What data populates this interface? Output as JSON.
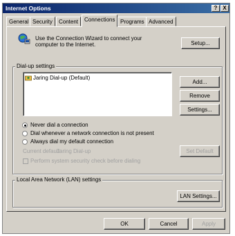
{
  "window": {
    "title": "Internet Options",
    "help_glyph": "?",
    "close_glyph": "X"
  },
  "tabs": [
    {
      "label": "General"
    },
    {
      "label": "Security"
    },
    {
      "label": "Content"
    },
    {
      "label": "Connections"
    },
    {
      "label": "Programs"
    },
    {
      "label": "Advanced"
    }
  ],
  "active_tab": "Connections",
  "setup": {
    "description": "Use the Connection Wizard to connect your computer to the Internet.",
    "button_label": "Setup..."
  },
  "dialup": {
    "group_label": "Dial-up settings",
    "connections": [
      "Jaring Dial-up (Default)"
    ],
    "add_label": "Add...",
    "remove_label": "Remove",
    "settings_label": "Settings...",
    "options": [
      {
        "label": "Never dial a connection",
        "selected": true
      },
      {
        "label": "Dial whenever a network connection is not present",
        "selected": false
      },
      {
        "label": "Always dial my default connection",
        "selected": false
      }
    ],
    "current_default_label": "Current default:",
    "current_default_value": "Jaring Dial-up",
    "set_default_label": "Set Default",
    "security_check_label": "Perform system security check before dialing"
  },
  "lan": {
    "group_label": "Local Area Network (LAN) settings",
    "button_label": "LAN Settings..."
  },
  "footer": {
    "ok_label": "OK",
    "cancel_label": "Cancel",
    "apply_label": "Apply"
  }
}
